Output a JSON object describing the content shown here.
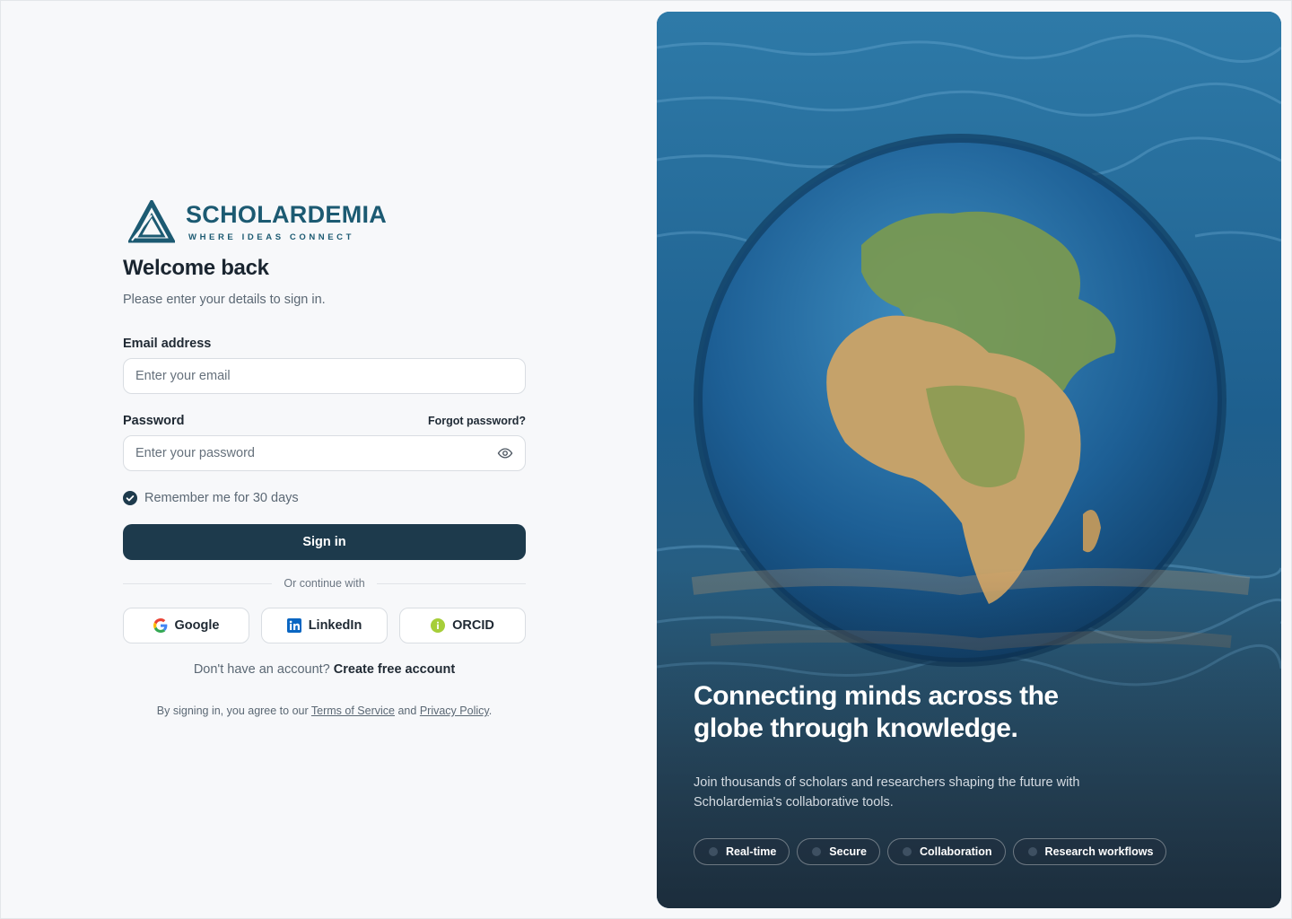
{
  "brand": {
    "name": "SCHOLARDEMIA",
    "tagline": "WHERE IDEAS CONNECT",
    "color": "#1c5a72"
  },
  "form": {
    "title": "Welcome back",
    "subtitle": "Please enter your details to sign in.",
    "email_label": "Email address",
    "email_placeholder": "Enter your email",
    "password_label": "Password",
    "forgot_label": "Forgot password?",
    "password_placeholder": "Enter your password",
    "remember_label": "Remember me for 30 days",
    "remember_checked": true,
    "signin_label": "Sign in",
    "divider_label": "Or continue with",
    "social": [
      {
        "label": "Google",
        "icon": "google-icon"
      },
      {
        "label": "LinkedIn",
        "icon": "linkedin-icon"
      },
      {
        "label": "ORCID",
        "icon": "orcid-icon"
      }
    ],
    "signup_prompt": "Don't have an account?",
    "signup_link": "Create free account",
    "terms_prefix": "By signing in, you agree to our",
    "terms_link": "Terms of Service",
    "terms_and": "and",
    "privacy_link": "Privacy Policy",
    "terms_suffix": ".",
    "primary_color": "#1d3a4c"
  },
  "hero": {
    "title": "Connecting minds across the globe through knowledge.",
    "subtitle": "Join thousands of scholars and researchers shaping the future with Scholardemia's collaborative tools.",
    "chips": [
      "Real-time",
      "Secure",
      "Collaboration",
      "Research workflows"
    ]
  }
}
